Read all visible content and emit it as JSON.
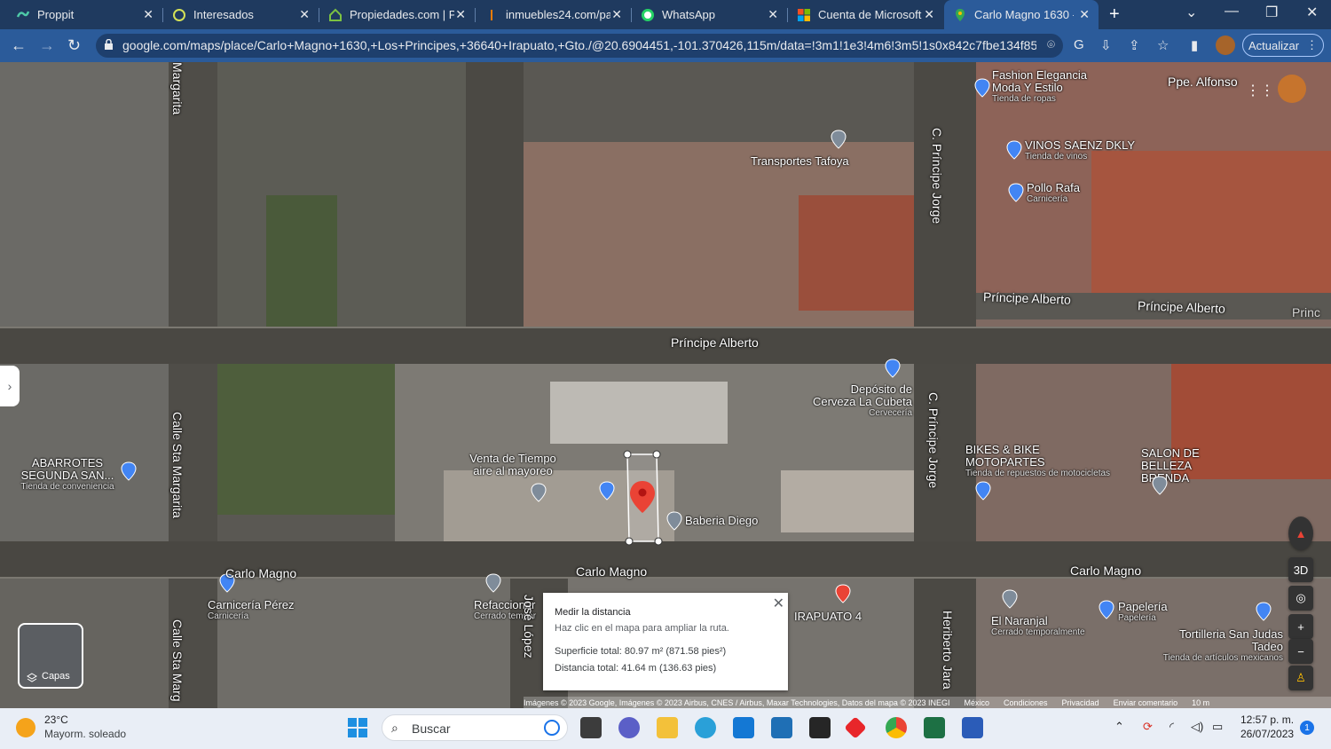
{
  "tabs": [
    {
      "label": "Proppit",
      "active": false
    },
    {
      "label": "Interesados",
      "active": false
    },
    {
      "label": "Propiedades.com | Pr",
      "active": false
    },
    {
      "label": "inmuebles24.com/par",
      "active": false
    },
    {
      "label": "WhatsApp",
      "active": false
    },
    {
      "label": "Cuenta de Microsoft |",
      "active": false
    },
    {
      "label": "Carlo Magno 1630 - C",
      "active": true
    }
  ],
  "address": {
    "url": "google.com/maps/place/Carlo+Magno+1630,+Los+Principes,+36640+Irapuato,+Gto./@20.6904451,-101.370426,115m/data=!3m1!1e3!4m6!3m5!1s0x842c7fbe134f850f...",
    "update_label": "Actualizar"
  },
  "map": {
    "places": [
      {
        "name": "Fashion Elegancia Moda Y Estilo",
        "type": "Tienda de ropas"
      },
      {
        "name": "VINOS SAENZ DKLY",
        "type": "Tienda de vinos"
      },
      {
        "name": "Pollo Rafa",
        "type": "Carnicería"
      },
      {
        "name": "Transportes Tafoya",
        "type": ""
      },
      {
        "name": "Depósito de Cerveza La Cubeta",
        "type": "Cervecería"
      },
      {
        "name": "ABARROTES SEGUNDA SAN...",
        "type": "Tienda de conveniencia"
      },
      {
        "name": "Venta de Tiempo aire al mayoreo",
        "type": ""
      },
      {
        "name": "Baberia Diego",
        "type": ""
      },
      {
        "name": "BIKES & BIKE MOTOPARTES",
        "type": "Tienda de repuestos de motocicletas"
      },
      {
        "name": "SALON DE BELLEZA BRENDA",
        "type": ""
      },
      {
        "name": "Carnicería Pérez",
        "type": "Carnicería"
      },
      {
        "name": "Refaccionar",
        "type": "Cerrado tempor"
      },
      {
        "name": "IRAPUATO 4",
        "type": ""
      },
      {
        "name": "El Naranjal",
        "type": "Cerrado temporalmente"
      },
      {
        "name": "Papelería",
        "type": "Papelería"
      },
      {
        "name": "Tortilleria San Judas Tadeo",
        "type": "Tienda de artículos mexicanos"
      }
    ],
    "streets": {
      "principe_alberto": "Príncipe Alberto",
      "principe_alberto_2": "Príncipe Alberto",
      "principe_alberto_3": "Princ",
      "carlo_magno": "Carlo Magno",
      "carlo_magno_2": "Carlo Magno",
      "carlo_magno_3": "Carlo Magno",
      "principe_jorge": "C. Príncipe Jorge",
      "principe_jorge_2": "C. Príncipe Jorge",
      "sta_margarita": "Calle Sta Margarita",
      "sta_margarita_2": "Calle Sta Marg",
      "margarita_top": "Margarita",
      "jose_lopez": "José López",
      "heriberto_jara": "Heriberto Jara",
      "ppe_alfonso": "Ppe. Alfonso"
    },
    "measure": {
      "title": "Medir la distancia",
      "hint": "Haz clic en el mapa para ampliar la ruta.",
      "area": "Superficie total: 80.97 m² (871.58 pies²)",
      "distance": "Distancia total: 41.64 m (136.63 pies)"
    },
    "layers_label": "Capas",
    "ctrl_3d": "3D",
    "attribution": [
      "Imágenes © 2023 Google, Imágenes © 2023 Airbus, CNES / Airbus, Maxar Technologies, Datos del mapa © 2023 INEGI",
      "México",
      "Condiciones",
      "Privacidad",
      "Enviar comentario",
      "10 m"
    ]
  },
  "taskbar": {
    "temperature": "23°C",
    "weather": "Mayorm. soleado",
    "search_placeholder": "Buscar",
    "time": "12:57 p. m.",
    "date": "26/07/2023",
    "notifications": "1"
  }
}
